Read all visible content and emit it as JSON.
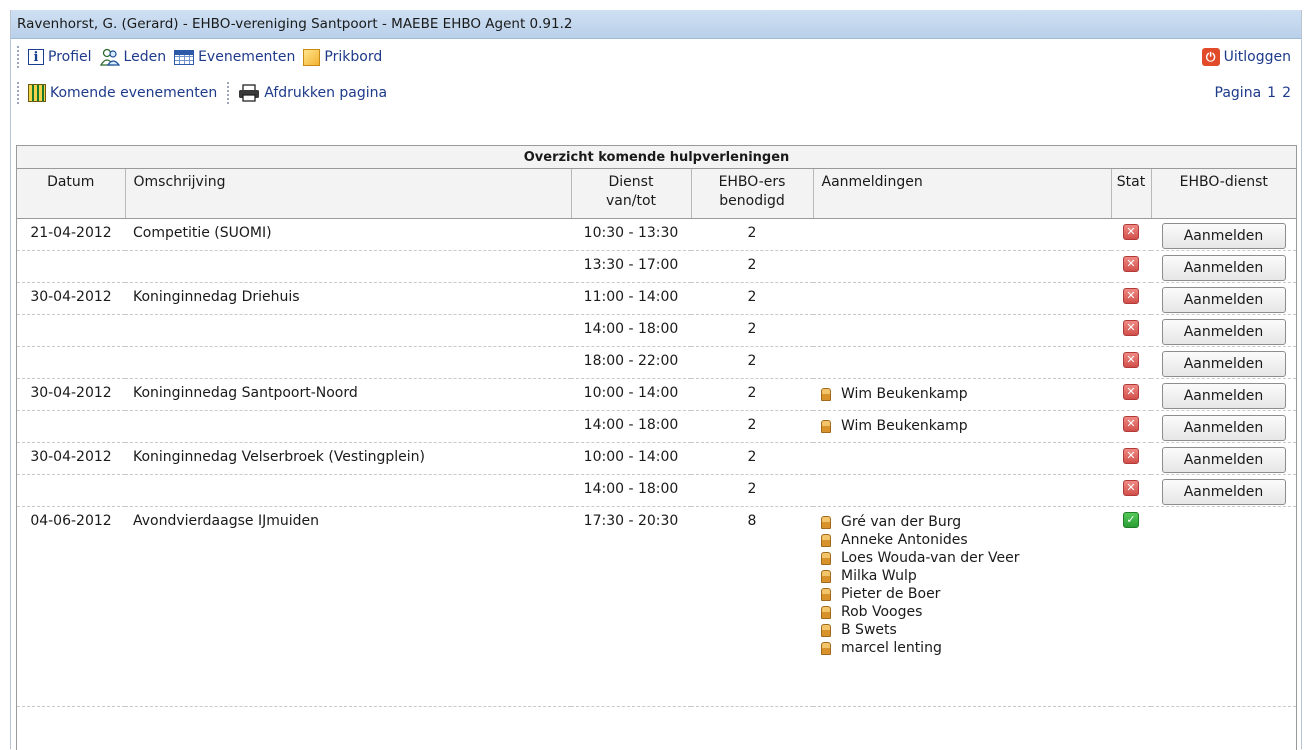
{
  "window": {
    "title": "Ravenhorst, G. (Gerard) - EHBO-vereniging Santpoort - MAEBE EHBO Agent 0.91.2"
  },
  "nav": {
    "profiel": "Profiel",
    "leden": "Leden",
    "evenementen": "Evenementen",
    "prikbord": "Prikbord",
    "uitloggen": "Uitloggen"
  },
  "subnav": {
    "komende": "Komende evenementen",
    "afdrukken": "Afdrukken pagina",
    "pagina_label": "Pagina",
    "pages": [
      "1",
      "2"
    ]
  },
  "table": {
    "caption": "Overzicht komende hulpverleningen",
    "headers": {
      "datum": "Datum",
      "omschrijving": "Omschrijving",
      "dienst_1": "Dienst",
      "dienst_2": "van/tot",
      "ehbo_1": "EHBO-ers",
      "ehbo_2": "benodigd",
      "aanmeldingen": "Aanmeldingen",
      "stat": "Stat",
      "dienst_col": "EHBO-dienst"
    },
    "button_label": "Aanmelden",
    "rows": [
      {
        "date": "21-04-2012",
        "desc": "Competitie (SUOMI)",
        "time": "10:30 - 13:30",
        "needed": "2",
        "regs": [],
        "status": "not-ok"
      },
      {
        "date": "",
        "desc": "",
        "time": "13:30 - 17:00",
        "needed": "2",
        "regs": [],
        "status": "not-ok"
      },
      {
        "date": "30-04-2012",
        "desc": "Koninginnedag Driehuis",
        "time": "11:00 - 14:00",
        "needed": "2",
        "regs": [],
        "status": "not-ok"
      },
      {
        "date": "",
        "desc": "",
        "time": "14:00 - 18:00",
        "needed": "2",
        "regs": [],
        "status": "not-ok"
      },
      {
        "date": "",
        "desc": "",
        "time": "18:00 - 22:00",
        "needed": "2",
        "regs": [],
        "status": "not-ok"
      },
      {
        "date": "30-04-2012",
        "desc": "Koninginnedag Santpoort-Noord",
        "time": "10:00 - 14:00",
        "needed": "2",
        "regs": [
          "Wim Beukenkamp"
        ],
        "status": "not-ok"
      },
      {
        "date": "",
        "desc": "",
        "time": "14:00 - 18:00",
        "needed": "2",
        "regs": [
          "Wim Beukenkamp"
        ],
        "status": "not-ok"
      },
      {
        "date": "30-04-2012",
        "desc": "Koninginnedag Velserbroek (Vestingplein)",
        "time": "10:00 - 14:00",
        "needed": "2",
        "regs": [],
        "status": "not-ok"
      },
      {
        "date": "",
        "desc": "",
        "time": "14:00 - 18:00",
        "needed": "2",
        "regs": [],
        "status": "not-ok"
      },
      {
        "date": "04-06-2012",
        "desc": "Avondvierdaagse IJmuiden",
        "time": "17:30 - 20:30",
        "needed": "8",
        "regs": [
          "Gré van der Burg",
          "Anneke Antonides",
          "Loes Wouda-van der Veer",
          "Milka Wulp",
          "Pieter de Boer",
          "Rob Vooges",
          "B Swets",
          "marcel lenting"
        ],
        "status": "ok"
      }
    ]
  },
  "colors": {
    "titlebar": "#c3d7ee",
    "link": "#1e3a8a",
    "status_bad": "#d2504b",
    "status_ok": "#2a9e33"
  }
}
